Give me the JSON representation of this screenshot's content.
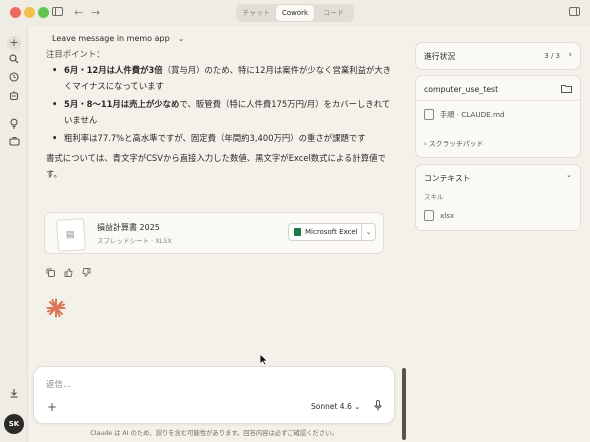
{
  "titlebar": {
    "tabs": [
      "チャット",
      "Cowork",
      "コード"
    ],
    "active_tab": "Cowork"
  },
  "rail": {
    "icons": [
      "plus-icon",
      "search-icon",
      "clock-icon",
      "robot-icon",
      "lightbulb-icon",
      "briefcase-icon",
      "download-icon"
    ],
    "avatar": "SK"
  },
  "chat": {
    "title": "Leave message in memo app",
    "cut_heading": "注目ポイント：",
    "bullets": [
      {
        "bold": "6月・12月は人件費が3倍",
        "rest": "（賞与月）のため、特に12月は案件が少なく営業利益が大きくマイナスになっています"
      },
      {
        "bold": "5月・8〜11月は売上が少なめ",
        "rest": "で、販管費（特に人件費175万円/月）をカバーしきれていません"
      },
      {
        "bold": "",
        "rest": "粗利率は77.7%と高水準ですが、固定費（年間約3,400万円）の重さが課題です"
      }
    ],
    "paragraph": "書式については、青文字がCSVから直接入力した数値、黒文字がExcel数式による計算値です。",
    "file": {
      "name": "損益計算書 2025",
      "subtitle": "スプレッドシート · XLSX",
      "open_with": "Microsoft Excel"
    }
  },
  "composer": {
    "placeholder": "返信...",
    "model": "Sonnet 4.6 ⌄",
    "disclaimer": "Claude は AI のため、誤りを含む可能性があります。回答内容は必ずご確認ください。"
  },
  "panel": {
    "progress_title": "進行状況",
    "progress_count": "3 / 3",
    "folder_title": "computer_use_test",
    "folder_file": "手順 · CLAUDE.md",
    "scratchpad": "スクラッチパッド",
    "context_title": "コンテキスト",
    "skills_label": "スキル",
    "skill_item": "xlsx"
  }
}
